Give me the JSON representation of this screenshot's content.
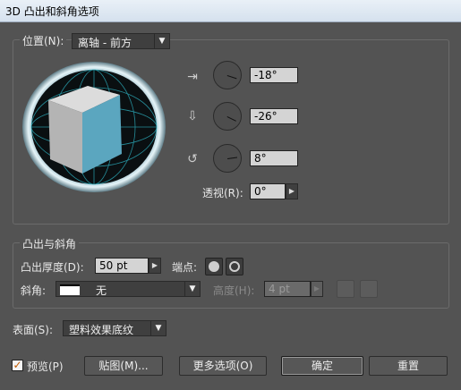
{
  "window": {
    "title": "3D 凸出和斜角选项"
  },
  "position_group": {
    "label": "位置(N):",
    "preset": "离轴 - 前方",
    "x_rotation": "-18°",
    "y_rotation": "-26°",
    "z_rotation": "8°",
    "perspective_label": "透视(R):",
    "perspective": "0°"
  },
  "extrude_group": {
    "title": "凸出与斜角",
    "depth_label": "凸出厚度(D):",
    "depth": "50 pt",
    "cap_label": "端点:",
    "bevel_label": "斜角:",
    "bevel": "无",
    "height_label": "高度(H):",
    "height": "4 pt"
  },
  "surface": {
    "label": "表面(S):",
    "value": "塑料效果底纹"
  },
  "footer": {
    "preview_label": "预览(P)",
    "preview_checked": true,
    "map_button": "贴图(M)...",
    "more_button": "更多选项(O)",
    "ok_button": "确定",
    "reset_button": "重置"
  },
  "colors": {
    "cube_front": "#5ba6bf",
    "cube_top": "#dcdcdc",
    "cube_side": "#b4b4b4",
    "track_glow": "#3fd0e0"
  }
}
